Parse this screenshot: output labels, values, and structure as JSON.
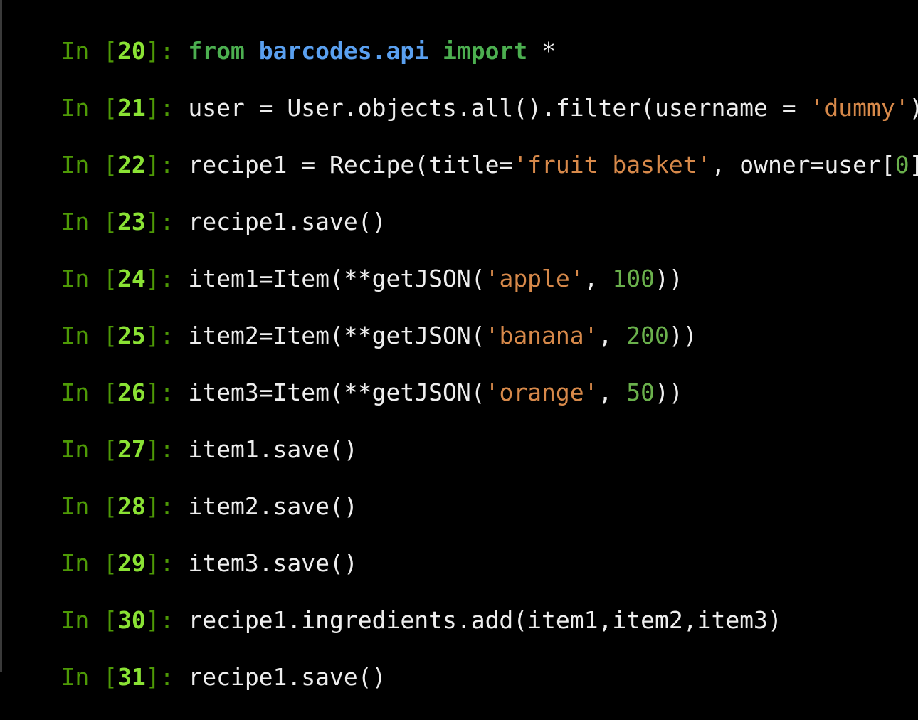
{
  "window": {
    "title": ""
  },
  "colors": {
    "background": "#000000",
    "prompt": "#4e9a06",
    "prompt_number": "#8ae234",
    "keyword": "#4caf50",
    "module": "#5aa0f0",
    "text": "#eeeeee",
    "string": "#d7894a",
    "number": "#6ab04c"
  },
  "prompt_label": "In",
  "cells": [
    {
      "n": "20",
      "tokens": [
        {
          "t": "from",
          "k": "kw"
        },
        {
          "t": " ",
          "k": "text"
        },
        {
          "t": "barcodes.api",
          "k": "mod"
        },
        {
          "t": " ",
          "k": "text"
        },
        {
          "t": "import",
          "k": "kw"
        },
        {
          "t": " *",
          "k": "text"
        }
      ]
    },
    {
      "n": "21",
      "tokens": [
        {
          "t": "user = User.objects.all().filter(username = ",
          "k": "text"
        },
        {
          "t": "'dummy'",
          "k": "str"
        },
        {
          "t": ")",
          "k": "text"
        }
      ]
    },
    {
      "n": "22",
      "tokens": [
        {
          "t": "recipe1 = Recipe(title=",
          "k": "text"
        },
        {
          "t": "'fruit basket'",
          "k": "str"
        },
        {
          "t": ", owner=user[",
          "k": "text"
        },
        {
          "t": "0",
          "k": "num"
        },
        {
          "t": "])",
          "k": "text"
        }
      ]
    },
    {
      "n": "23",
      "tokens": [
        {
          "t": "recipe1.save()",
          "k": "text"
        }
      ]
    },
    {
      "n": "24",
      "tokens": [
        {
          "t": "item1=Item(**getJSON(",
          "k": "text"
        },
        {
          "t": "'apple'",
          "k": "str"
        },
        {
          "t": ", ",
          "k": "text"
        },
        {
          "t": "100",
          "k": "num"
        },
        {
          "t": "))",
          "k": "text"
        }
      ]
    },
    {
      "n": "25",
      "tokens": [
        {
          "t": "item2=Item(**getJSON(",
          "k": "text"
        },
        {
          "t": "'banana'",
          "k": "str"
        },
        {
          "t": ", ",
          "k": "text"
        },
        {
          "t": "200",
          "k": "num"
        },
        {
          "t": "))",
          "k": "text"
        }
      ]
    },
    {
      "n": "26",
      "tokens": [
        {
          "t": "item3=Item(**getJSON(",
          "k": "text"
        },
        {
          "t": "'orange'",
          "k": "str"
        },
        {
          "t": ", ",
          "k": "text"
        },
        {
          "t": "50",
          "k": "num"
        },
        {
          "t": "))",
          "k": "text"
        }
      ]
    },
    {
      "n": "27",
      "tokens": [
        {
          "t": "item1.save()",
          "k": "text"
        }
      ]
    },
    {
      "n": "28",
      "tokens": [
        {
          "t": "item2.save()",
          "k": "text"
        }
      ]
    },
    {
      "n": "29",
      "tokens": [
        {
          "t": "item3.save()",
          "k": "text"
        }
      ]
    },
    {
      "n": "30",
      "tokens": [
        {
          "t": "recipe1.ingredients.add(item1,item2,item3)",
          "k": "text"
        }
      ]
    },
    {
      "n": "31",
      "tokens": [
        {
          "t": "recipe1.save()",
          "k": "text"
        }
      ]
    }
  ]
}
